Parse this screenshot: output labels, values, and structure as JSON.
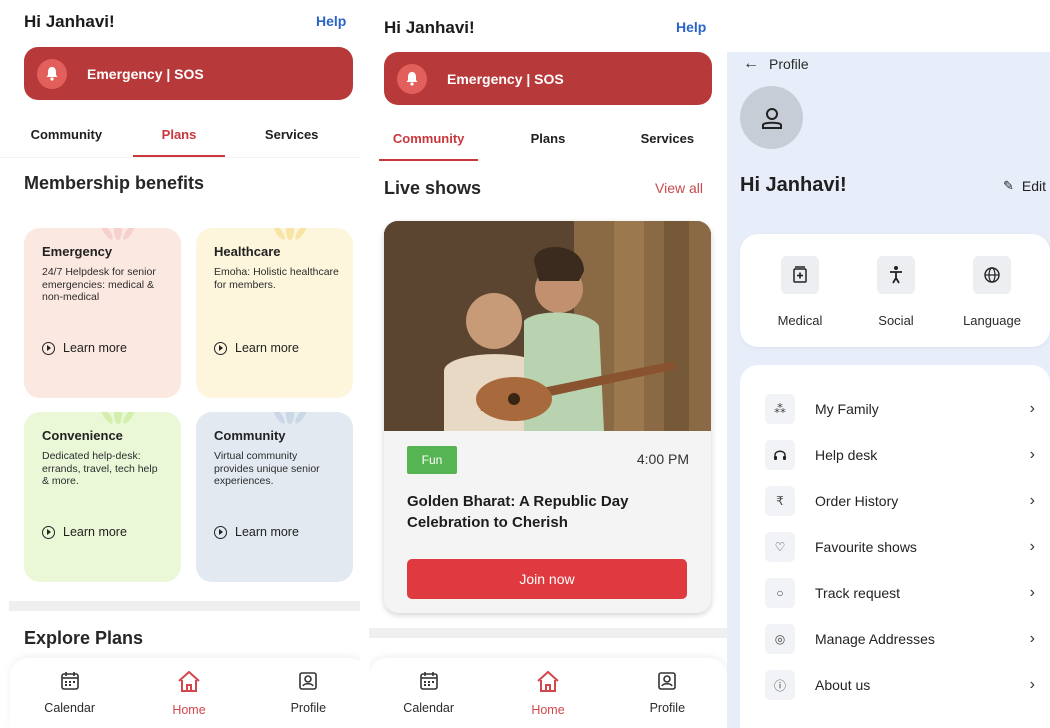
{
  "screen1": {
    "greeting": "Hi Janhavi!",
    "help": "Help",
    "sos_label": "Emergency | SOS",
    "tabs": [
      {
        "label": "Community",
        "active": false
      },
      {
        "label": "Plans",
        "active": true
      },
      {
        "label": "Services",
        "active": false
      }
    ],
    "section_title": "Membership benefits",
    "benefit_cards": [
      {
        "title": "Emergency",
        "desc": "24/7 Helpdesk for senior emergencies: medical & non-medical",
        "cta": "Learn more",
        "bg": "#fbe8e1"
      },
      {
        "title": "Healthcare",
        "desc": "Emoha: Holistic healthcare for members.",
        "cta": "Learn more",
        "bg": "#fdf6dc"
      },
      {
        "title": "Convenience",
        "desc": "Dedicated help-desk: errands, travel, tech help & more.",
        "cta": "Learn more",
        "bg": "#eaf8d8"
      },
      {
        "title": "Community",
        "desc": "Virtual community provides unique senior experiences.",
        "cta": "Learn more",
        "bg": "#e2e9f1"
      }
    ],
    "explore_title": "Explore Plans",
    "nav": [
      {
        "label": "Calendar",
        "icon": "calendar-icon",
        "active": false
      },
      {
        "label": "Home",
        "icon": "home-icon",
        "active": true
      },
      {
        "label": "Profile",
        "icon": "profile-icon",
        "active": false
      }
    ]
  },
  "screen2": {
    "greeting": "Hi Janhavi!",
    "help": "Help",
    "sos_label": "Emergency | SOS",
    "tabs": [
      {
        "label": "Community",
        "active": true
      },
      {
        "label": "Plans",
        "active": false
      },
      {
        "label": "Services",
        "active": false
      }
    ],
    "section_title": "Live shows",
    "view_all": "View all",
    "show": {
      "tag": "Fun",
      "time": "4:00 PM",
      "title": "Golden Bharat: A Republic Day Celebration to Cherish",
      "cta": "Join now"
    },
    "nav": [
      {
        "label": "Calendar",
        "icon": "calendar-icon",
        "active": false
      },
      {
        "label": "Home",
        "icon": "home-icon",
        "active": true
      },
      {
        "label": "Profile",
        "icon": "profile-icon",
        "active": false
      }
    ]
  },
  "screen3": {
    "back_label": "Profile",
    "greeting": "Hi Janhavi!",
    "edit": "Edit",
    "prefs": [
      {
        "label": "Medical",
        "icon": "medical-icon"
      },
      {
        "label": "Social",
        "icon": "social-icon"
      },
      {
        "label": "Language",
        "icon": "globe-icon"
      }
    ],
    "menu": [
      {
        "label": "My Family",
        "icon": "family-icon"
      },
      {
        "label": "Help desk",
        "icon": "headset-icon"
      },
      {
        "label": "Order History",
        "icon": "rupee-icon"
      },
      {
        "label": "Favourite shows",
        "icon": "heart-icon"
      },
      {
        "label": "Track request",
        "icon": "track-icon"
      },
      {
        "label": "Manage Addresses",
        "icon": "location-icon"
      },
      {
        "label": "About us",
        "icon": "info-icon"
      }
    ]
  },
  "colors": {
    "brand_red": "#b8393a",
    "accent_red": "#c9373c",
    "help_blue": "#2b64c9",
    "fun_green": "#56b552",
    "profile_bg": "#e8eef9"
  }
}
